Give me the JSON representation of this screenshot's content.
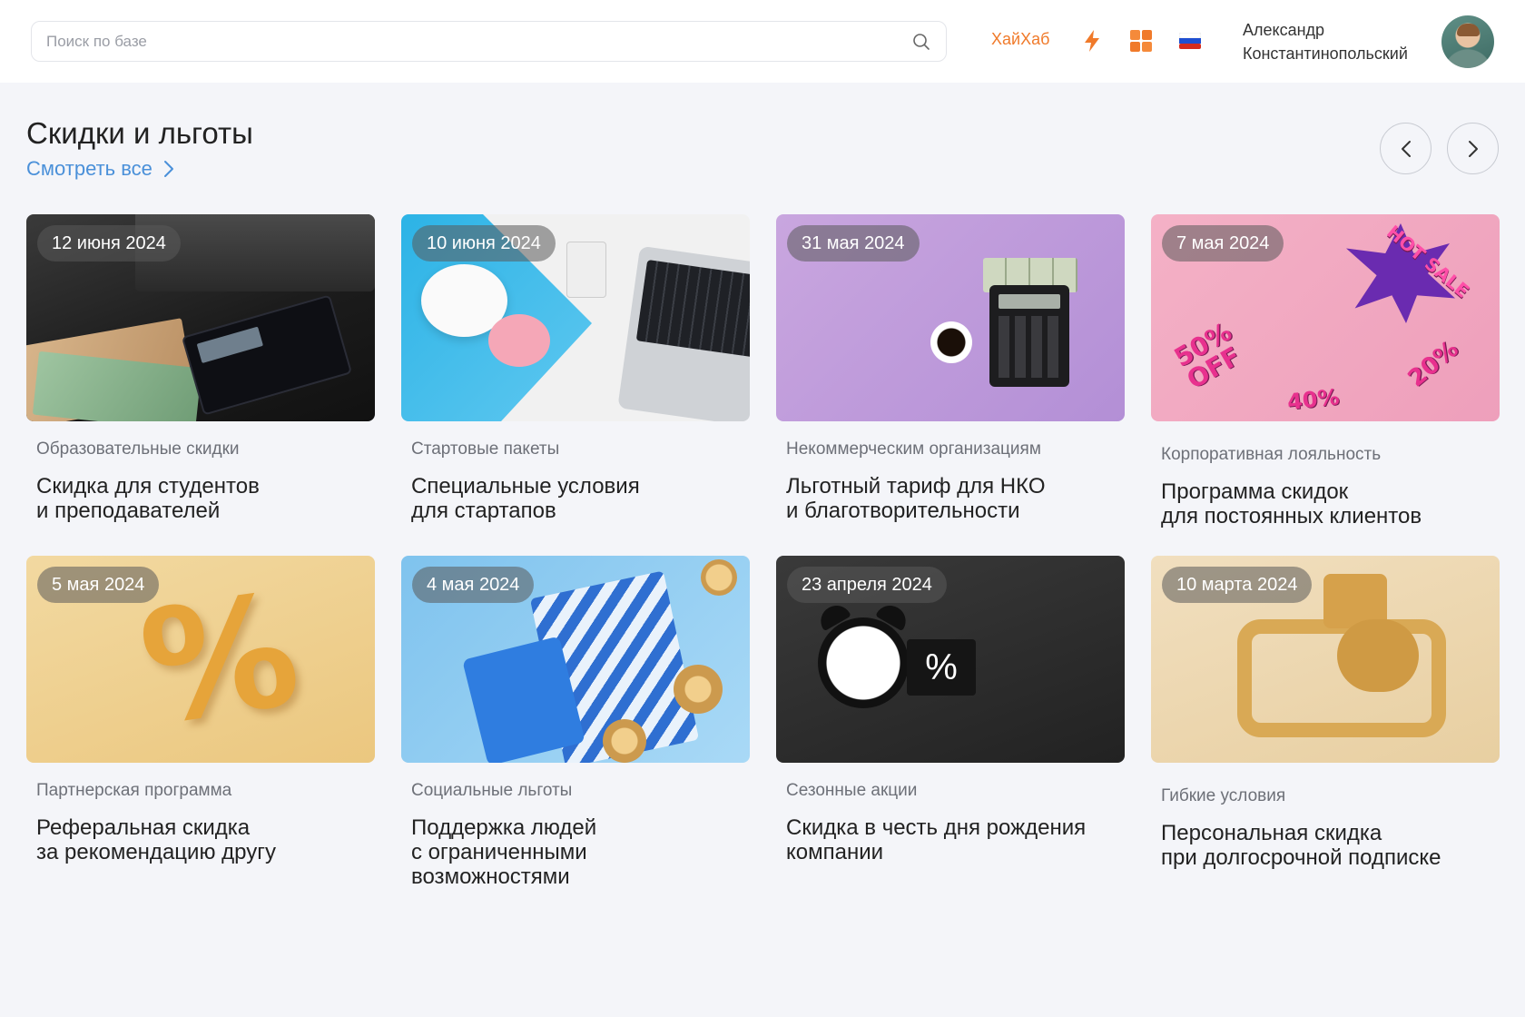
{
  "header": {
    "search_placeholder": "Поиск по базе",
    "brand": "ХайХаб",
    "user_name_line1": "Александр",
    "user_name_line2": "Константинопольский"
  },
  "colors": {
    "accent_orange": "#f07a2a",
    "link_blue": "#4a90d9",
    "background": "#f4f5f9"
  },
  "section": {
    "title": "Скидки и льготы",
    "see_all": "Смотреть все"
  },
  "cards": [
    {
      "date": "12 июня 2024",
      "category": "Образовательные скидки",
      "title": "Скидка для студентов\nи преподавателей"
    },
    {
      "date": "10 июня 2024",
      "category": "Стартовые пакеты",
      "title": "Специальные условия\nдля стартапов"
    },
    {
      "date": "31 мая 2024",
      "category": "Некоммерческим организациям",
      "title": "Льготный тариф для НКО\nи благотворительности"
    },
    {
      "date": "7 мая 2024",
      "category": "Корпоративная лояльность",
      "title": "Программа скидок\nдля постоянных клиентов"
    },
    {
      "date": "5 мая 2024",
      "category": "Партнерская программа",
      "title": "Реферальная скидка\nза рекомендацию другу"
    },
    {
      "date": "4 мая 2024",
      "category": "Социальные льготы",
      "title": "Поддержка людей\nс ограниченными\nвозможностями"
    },
    {
      "date": "23 апреля 2024",
      "category": "Сезонные акции",
      "title": "Скидка в честь дня рождения\nкомпании"
    },
    {
      "date": "10 марта 2024",
      "category": "Гибкие условия",
      "title": "Персональная скидка\nпри долгосрочной подписке"
    }
  ],
  "image_text": {
    "card4_sale": "HOT SALE",
    "card4_50": "50% OFF",
    "card4_40": "40%",
    "card4_20": "20%",
    "card5_pct": "%",
    "card7_pct": "%"
  }
}
